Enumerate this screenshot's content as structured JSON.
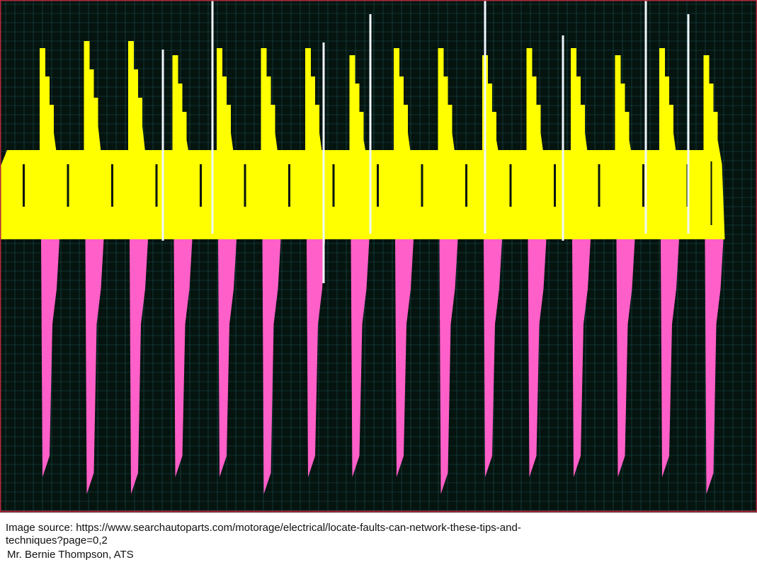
{
  "colors": {
    "background": "#05140f",
    "grid": "#2f7f8a",
    "frame": "#b0283c",
    "channel_a": "#ffff00",
    "channel_b": "#ff5fc8",
    "spike": "#f0f7ff"
  },
  "chart_data": {
    "type": "line",
    "title": "",
    "xlabel": "",
    "ylabel": "",
    "grid": true,
    "legend": "none",
    "x": [
      1,
      2,
      3,
      4,
      5,
      6,
      7,
      8,
      9,
      10,
      11,
      12,
      13,
      14,
      15,
      16
    ],
    "series": [
      {
        "color": "#ffff00",
        "values": [
          2.7,
          2.8,
          2.8,
          2.6,
          2.7,
          2.7,
          2.7,
          2.6,
          2.7,
          2.7,
          2.6,
          2.7,
          2.7,
          2.6,
          2.7,
          2.6
        ]
      },
      {
        "color": "#ff5fc8",
        "values": [
          -1.4,
          -1.5,
          -1.5,
          -1.4,
          -1.4,
          -1.5,
          -1.4,
          -1.4,
          -1.4,
          -1.5,
          -1.4,
          -1.4,
          -1.4,
          -1.4,
          -1.4,
          -1.5
        ]
      }
    ]
  },
  "caption": {
    "source": "Image source: https://www.searchautoparts.com/motorage/electrical/locate-faults-can-network-these-tips-and-techniques?page=0,2",
    "credit": "Mr. Bernie Thompson, ATS"
  }
}
